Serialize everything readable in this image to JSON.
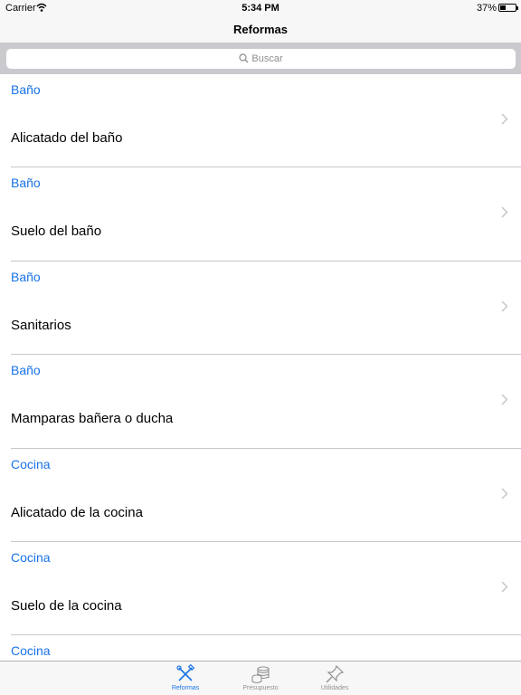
{
  "status_bar": {
    "carrier": "Carrier",
    "time": "5:34 PM",
    "battery_percent": "37%",
    "battery_level": 0.37
  },
  "nav": {
    "title": "Reformas"
  },
  "search": {
    "placeholder": "Buscar"
  },
  "list": {
    "items": [
      {
        "category": "Baño",
        "name": "Alicatado del baño"
      },
      {
        "category": "Baño",
        "name": "Suelo del baño"
      },
      {
        "category": "Baño",
        "name": "Sanitarios"
      },
      {
        "category": "Baño",
        "name": "Mamparas bañera o ducha"
      },
      {
        "category": "Cocina",
        "name": "Alicatado de la cocina"
      },
      {
        "category": "Cocina",
        "name": "Suelo de la cocina"
      },
      {
        "category": "Cocina",
        "name": ""
      }
    ]
  },
  "tab_bar": {
    "tabs": [
      {
        "label": "Reformas",
        "icon": "tools-icon",
        "active": true
      },
      {
        "label": "Presupuesto",
        "icon": "coins-icon",
        "active": false
      },
      {
        "label": "Utilidades",
        "icon": "pin-icon",
        "active": false
      }
    ]
  },
  "colors": {
    "accent": "#1a73e8",
    "separator": "#c8c7cc",
    "bar_background": "#f7f7f7",
    "search_background": "#c9c9ce"
  }
}
